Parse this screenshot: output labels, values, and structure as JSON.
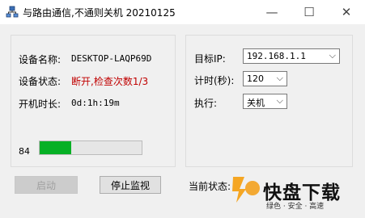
{
  "window": {
    "title": "与路由通信,不通则关机 20210125",
    "minimize_glyph": "—",
    "maximize_glyph": "☐",
    "close_glyph": "✕"
  },
  "device": {
    "name_label": "设备名称:",
    "name_value": "DESKTOP-LAQP69D",
    "status_label": "设备状态:",
    "status_value": "断开,检查次数1/3",
    "uptime_label": "开机时长:",
    "uptime_value": "0d:1h:19m"
  },
  "progress": {
    "value_text": "84",
    "fraction": 0.31
  },
  "settings": {
    "target_ip_label": "目标IP:",
    "target_ip_value": "192.168.1.1",
    "timer_label": "计时(秒):",
    "timer_value": "120",
    "action_label": "执行:",
    "action_value": "关机"
  },
  "buttons": {
    "start": "启动",
    "stop": "停止监视"
  },
  "status": {
    "current_label": "当前状态:"
  },
  "watermark": {
    "main_text": "快盘下载",
    "sub_text": "绿色 · 安全 · 高速"
  },
  "colors": {
    "progress_fill": "#06b025",
    "status_red": "#c00000"
  }
}
